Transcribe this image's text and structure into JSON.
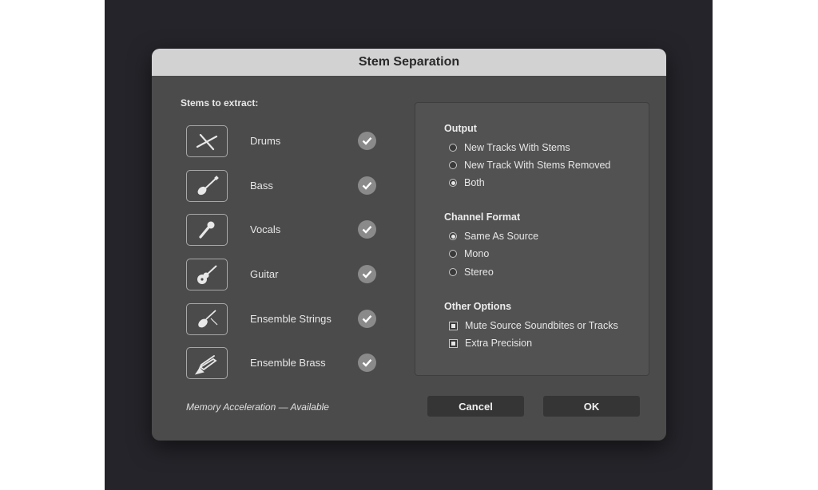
{
  "dialog": {
    "title": "Stem Separation",
    "stems_heading": "Stems to extract:",
    "stems": [
      {
        "label": "Drums",
        "icon": "drumsticks-icon",
        "checked": true
      },
      {
        "label": "Bass",
        "icon": "bass-guitar-icon",
        "checked": true
      },
      {
        "label": "Vocals",
        "icon": "microphone-icon",
        "checked": true
      },
      {
        "label": "Guitar",
        "icon": "acoustic-guitar-icon",
        "checked": true
      },
      {
        "label": "Ensemble Strings",
        "icon": "violin-icon",
        "checked": true
      },
      {
        "label": "Ensemble Brass",
        "icon": "trombone-icon",
        "checked": true
      }
    ],
    "memory_note": "Memory Acceleration — Available",
    "output": {
      "heading": "Output",
      "options": [
        "New Tracks With Stems",
        "New Track With Stems Removed",
        "Both"
      ],
      "selected": "Both"
    },
    "channel_format": {
      "heading": "Channel Format",
      "options": [
        "Same As Source",
        "Mono",
        "Stereo"
      ],
      "selected": "Same As Source"
    },
    "other_options": {
      "heading": "Other Options",
      "options": [
        {
          "label": "Mute Source Soundbites or Tracks",
          "checked": true
        },
        {
          "label": "Extra Precision",
          "checked": true
        }
      ]
    },
    "buttons": {
      "cancel": "Cancel",
      "ok": "OK"
    }
  }
}
